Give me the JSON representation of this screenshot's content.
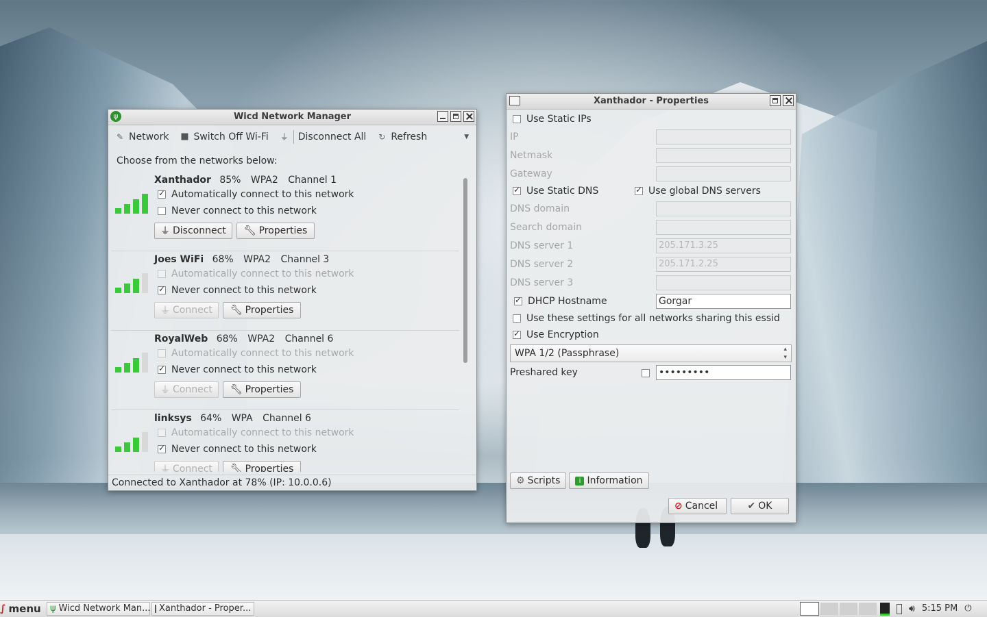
{
  "wicd": {
    "title": "Wicd Network Manager",
    "toolbar": {
      "network": "Network",
      "switch_off": "Switch Off Wi-Fi",
      "disconnect_all": "Disconnect All",
      "refresh": "Refresh"
    },
    "choose_label": "Choose from the networks below:",
    "networks": [
      {
        "name": "Xanthador",
        "strength": "85%",
        "security": "WPA2",
        "channel": "Channel 1",
        "auto_label": "Automatically connect to this network",
        "never_label": "Never connect to this network",
        "auto_checked": true,
        "never_checked": false,
        "connect_label": "Disconnect",
        "properties_label": "Properties",
        "signal_level": 4,
        "connected": true
      },
      {
        "name": "Joes WiFi",
        "strength": "68%",
        "security": "WPA2",
        "channel": "Channel 3",
        "auto_label": "Automatically connect to this network",
        "never_label": "Never connect to this network",
        "auto_checked": false,
        "never_checked": true,
        "connect_label": "Connect",
        "properties_label": "Properties",
        "signal_level": 3,
        "connected": false
      },
      {
        "name": "RoyalWeb",
        "strength": "68%",
        "security": "WPA2",
        "channel": "Channel 6",
        "auto_label": "Automatically connect to this network",
        "never_label": "Never connect to this network",
        "auto_checked": false,
        "never_checked": true,
        "connect_label": "Connect",
        "properties_label": "Properties",
        "signal_level": 3,
        "connected": false
      },
      {
        "name": "linksys",
        "strength": "64%",
        "security": "WPA",
        "channel": "Channel 6",
        "auto_label": "Automatically connect to this network",
        "never_label": "Never connect to this network",
        "auto_checked": false,
        "never_checked": true,
        "connect_label": "Connect",
        "properties_label": "Properties",
        "signal_level": 3,
        "connected": false
      }
    ],
    "status": "Connected to Xanthador at 78% (IP: 10.0.0.6)"
  },
  "props": {
    "title": "Xanthador - Properties",
    "use_static_ips": "Use Static IPs",
    "ip": "IP",
    "netmask": "Netmask",
    "gateway": "Gateway",
    "use_static_dns": "Use Static DNS",
    "use_global_dns": "Use global DNS servers",
    "dns_domain": "DNS domain",
    "search_domain": "Search domain",
    "dns_server_1": "DNS server 1",
    "dns_server_1_value": "205.171.3.25",
    "dns_server_2": "DNS server 2",
    "dns_server_2_value": "205.171.2.25",
    "dns_server_3": "DNS server 3",
    "dhcp_hostname": "DHCP Hostname",
    "dhcp_hostname_value": "Gorgar",
    "use_for_all": "Use these settings for all networks sharing this essid",
    "use_encryption": "Use Encryption",
    "encryption_type": "WPA 1/2 (Passphrase)",
    "preshared_key": "Preshared key",
    "preshared_value": "•••••••••",
    "scripts": "Scripts",
    "information": "Information",
    "cancel": "Cancel",
    "ok": "OK"
  },
  "taskbar": {
    "menu": "menu",
    "task1": "Wicd Network Man...",
    "task2": "Xanthador - Proper...",
    "clock": "5:15 PM"
  },
  "colors": {
    "signal": "#3cc83c",
    "signal_off": "#d8d8d8",
    "cancel_icon": "#cc2222",
    "info_icon": "#2f9a2f"
  }
}
